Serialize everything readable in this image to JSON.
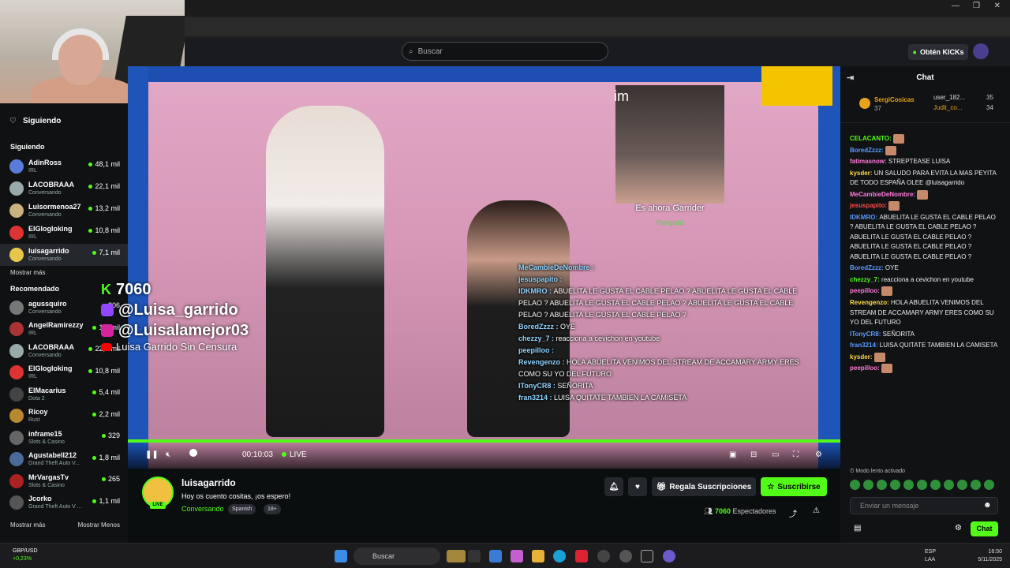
{
  "browser": {
    "tabs_icons": [
      "aa-icon",
      "star-icon",
      "extensions-icon"
    ]
  },
  "topbar": {
    "search_placeholder": "Buscar",
    "kicks_label": "Obtén KICKs"
  },
  "sidebar": {
    "siguiendo_header": "Siguiendo",
    "top_item": "Siguiendo",
    "following": [
      {
        "name": "AdinRoss",
        "cat": "IRL",
        "viewers": "48,1 mil",
        "color": "#5a7bd8"
      },
      {
        "name": "LACOBRAAA",
        "cat": "Conversando",
        "viewers": "22,1 mil",
        "color": "#9aa"
      },
      {
        "name": "Luisormenoa27",
        "cat": "Conversando",
        "viewers": "13,2 mil",
        "color": "#c9b27d"
      },
      {
        "name": "ElGlogloking",
        "cat": "IRL",
        "viewers": "10,8 mil",
        "color": "#d33"
      },
      {
        "name": "luisagarrido",
        "cat": "Conversando",
        "viewers": "7,1 mil",
        "color": "#e7c64b"
      }
    ],
    "mostrar_mas": "Mostrar más",
    "recomendado_header": "Recomendado",
    "recommended": [
      {
        "name": "agussquiro",
        "cat": "Conversando",
        "viewers": "206",
        "color": "#777"
      },
      {
        "name": "AngelRamirezzy",
        "cat": "IRL",
        "viewers": "1,7 mil",
        "color": "#a33"
      },
      {
        "name": "LACOBRAAA",
        "cat": "Conversando",
        "viewers": "22,2 mil",
        "color": "#9aa"
      },
      {
        "name": "ElGlogloking",
        "cat": "IRL",
        "viewers": "10,8 mil",
        "color": "#d33"
      },
      {
        "name": "ElMacarius",
        "cat": "Dota 2",
        "viewers": "5,4 mil",
        "color": "#444"
      },
      {
        "name": "Ricoy",
        "cat": "Rust",
        "viewers": "2,2 mil",
        "color": "#b8882f"
      },
      {
        "name": "inframe15",
        "cat": "Slots & Casino",
        "viewers": "329",
        "color": "#666"
      },
      {
        "name": "Agustabell212",
        "cat": "Grand Theft Auto V...",
        "viewers": "1,8 mil",
        "color": "#4a6a9a"
      },
      {
        "name": "MrVargasTv",
        "cat": "Slots & Casino",
        "viewers": "265",
        "color": "#a22"
      },
      {
        "name": "Jcorko",
        "cat": "Grand Theft Auto V ...",
        "viewers": "1,1 mil",
        "color": "#555"
      }
    ],
    "mostrar_mas2": "Mostrar más",
    "mostrar_menos": "Mostrar Menos"
  },
  "video": {
    "im": "im",
    "cam_caption": "Es ahora Garrider",
    "cam_sub": "Panigddd",
    "kick_count": "7060",
    "socials": [
      "@Luisa_garrido",
      "@Luisalamejor03"
    ],
    "yt": "Luisa Garrido Sin Censura",
    "inchat": [
      {
        "u": "MeCambieDeNombre",
        "t": ""
      },
      {
        "u": "jesuspapito",
        "t": ""
      },
      {
        "u": "IDKMRO",
        "t": "ABUELITA LE GUSTA EL CABLE PELAO ? ABUELITA LE GUSTA EL CABLE PELAO ? ABUELITA LE GUSTA EL CABLE PELAO ? ABUELITA LE GUSTA EL CABLE PELAO ? ABUELITA LE GUSTA EL CABLE PELAO ?"
      },
      {
        "u": "BoredZzzz",
        "t": "OYE"
      },
      {
        "u": "chezzy_7",
        "t": "reacciona a cevichon en youtube"
      },
      {
        "u": "peepilloo",
        "t": ""
      },
      {
        "u": "Revengenzo",
        "t": "HOLA ABUELITA VENIMOS DEL STREAM DE ACCAMARY ARMY ERES COMO SU YO DEL FUTURO"
      },
      {
        "u": "ITonyCR8",
        "t": "SEÑORITA"
      },
      {
        "u": "fran3214",
        "t": "LUISA QUITATE TAMBIEN LA CAMISETA"
      }
    ],
    "time": "00:10:03",
    "live": "LIVE"
  },
  "stream": {
    "name": "luisagarrido",
    "title": "Hoy os cuento cositas, ¡os espero!",
    "category": "Conversando",
    "tags": [
      "Spanish",
      "18+"
    ],
    "live_badge": "LIVE",
    "gift_label": "Regala Suscripciones",
    "sub_label": "Suscribirse",
    "viewers_num": "7060",
    "viewers_label": "Espectadores"
  },
  "chat": {
    "title": "Chat",
    "pinned": {
      "user": "SergiCosicas",
      "count": "37",
      "top": [
        {
          "u": "user_182...",
          "n": "35"
        },
        {
          "u": "Judit_co...",
          "n": "34"
        }
      ]
    },
    "messages": [
      {
        "u": "CELACANTO:",
        "t": "",
        "c": "#53fc18"
      },
      {
        "u": "BoredZzzz:",
        "t": "",
        "c": "#5a9bff"
      },
      {
        "u": "fatimasnow:",
        "t": "STREPTEASE LUISA",
        "c": "#ff7ad9"
      },
      {
        "u": "kysder:",
        "t": "UN SALUDO PARA EVITA LA MAS PEYITA DE TODO ESPAÑA OLEE @luisagarrido",
        "c": "#ffd84a"
      },
      {
        "u": "MeCambieDeNombre:",
        "t": "",
        "c": "#ff7ad9"
      },
      {
        "u": "jesuspapito:",
        "t": "",
        "c": "#ff4a4a"
      },
      {
        "u": "IDKMRO:",
        "t": "ABUELITA LE GUSTA EL CABLE PELAO ? ABUELITA LE GUSTA EL CABLE PELAO ? ABUELITA LE GUSTA EL CABLE PELAO ? ABUELITA LE GUSTA EL CABLE PELAO ? ABUELITA LE GUSTA EL CABLE PELAO ?",
        "c": "#5a9bff"
      },
      {
        "u": "BoredZzzz:",
        "t": "OYE",
        "c": "#5a9bff"
      },
      {
        "u": "chezzy_7:",
        "t": "reacciona a cevichon en youtube",
        "c": "#53fc18"
      },
      {
        "u": "peepilloo:",
        "t": "",
        "c": "#ff7ad9"
      },
      {
        "u": "Revengenzo:",
        "t": "HOLA ABUELITA VENIMOS DEL STREAM DE ACCAMARY ARMY ERES COMO SU YO DEL FUTURO",
        "c": "#ffd84a"
      },
      {
        "u": "ITonyCR8:",
        "t": "SEÑORITA",
        "c": "#5a9bff"
      },
      {
        "u": "fran3214:",
        "t": "LUISA QUITATE TAMBIEN LA CAMISETA",
        "c": "#5a9bff"
      },
      {
        "u": "kysder:",
        "t": "",
        "c": "#ffd84a"
      },
      {
        "u": "peepilloo:",
        "t": "",
        "c": "#ff7ad9"
      }
    ],
    "slow_mode": "Modo lento activado",
    "input_placeholder": "Enviar un mensaje",
    "send_label": "Chat"
  },
  "taskbar": {
    "ticker_pair": "GBP/USD",
    "ticker_change": "+0,23%",
    "search": "Buscar",
    "lang": "ESP",
    "lang2": "LAA",
    "time": "16:50",
    "date": "5/11/2025"
  }
}
